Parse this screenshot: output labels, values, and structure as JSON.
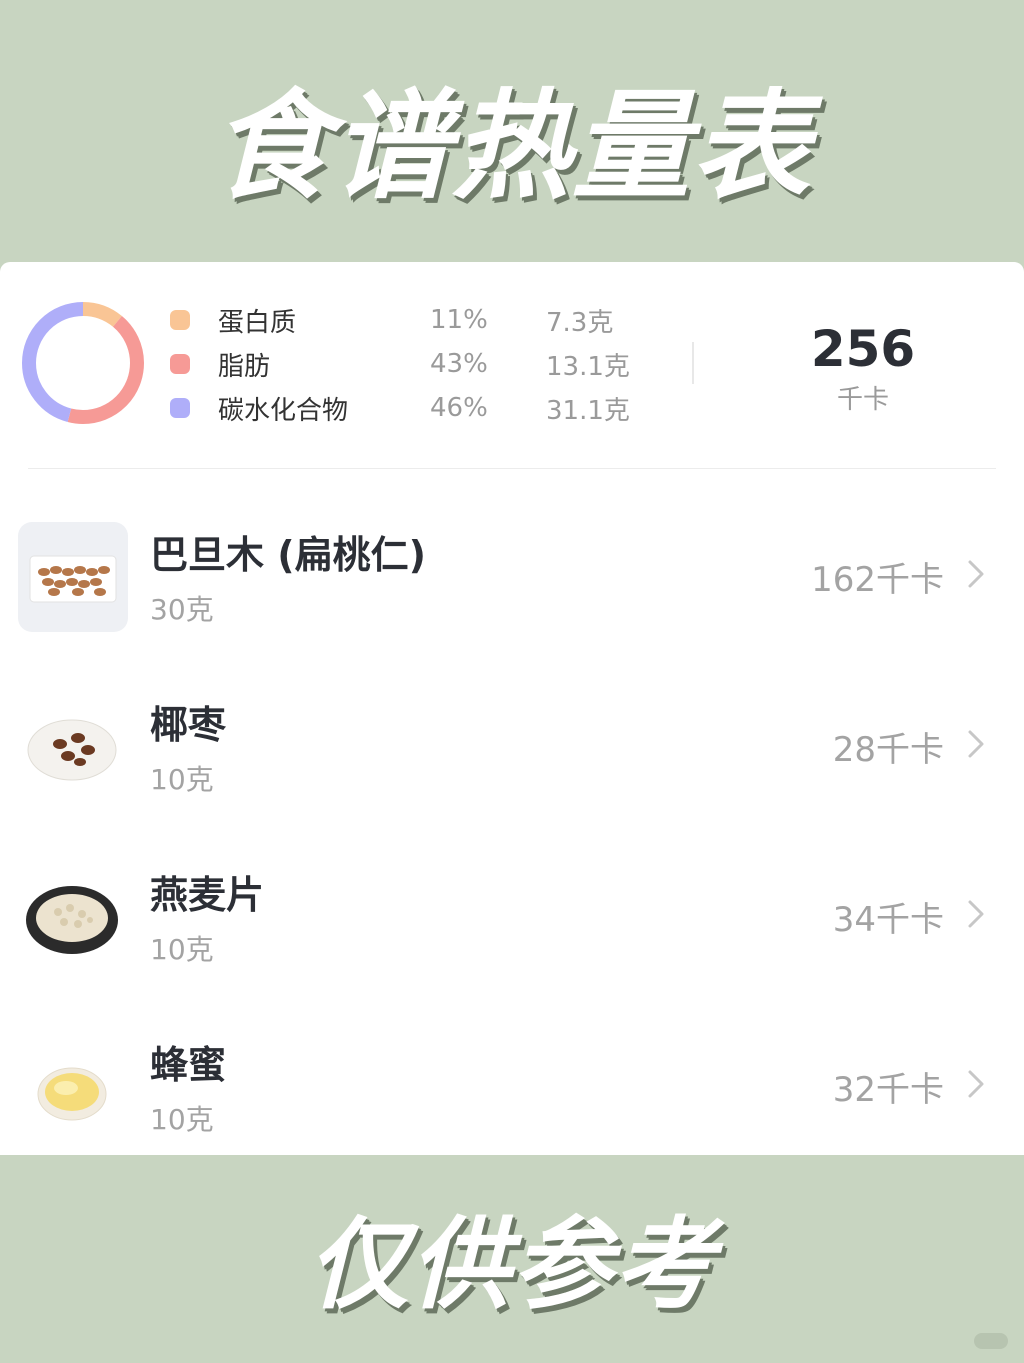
{
  "header": {
    "title": "食谱热量表"
  },
  "summary": {
    "macros": [
      {
        "name": "蛋白质",
        "percent": "11%",
        "grams": "7.3克",
        "color": "#f9c595",
        "fraction": 0.11
      },
      {
        "name": "脂肪",
        "percent": "43%",
        "grams": "13.1克",
        "color": "#f69a96",
        "fraction": 0.43
      },
      {
        "name": "碳水化合物",
        "percent": "46%",
        "grams": "31.1克",
        "color": "#afaef9",
        "fraction": 0.46
      }
    ],
    "total_kcal": "256",
    "kcal_unit": "千卡"
  },
  "foods": [
    {
      "name": "巴旦木 (扁桃仁)",
      "weight": "30克",
      "kcal": "162千卡",
      "icon": "almonds-icon"
    },
    {
      "name": "椰枣",
      "weight": "10克",
      "kcal": "28千卡",
      "icon": "dates-icon"
    },
    {
      "name": "燕麦片",
      "weight": "10克",
      "kcal": "34千卡",
      "icon": "oats-icon"
    },
    {
      "name": "蜂蜜",
      "weight": "10克",
      "kcal": "32千卡",
      "icon": "honey-icon"
    }
  ],
  "footer": {
    "text": "仅供参考"
  }
}
